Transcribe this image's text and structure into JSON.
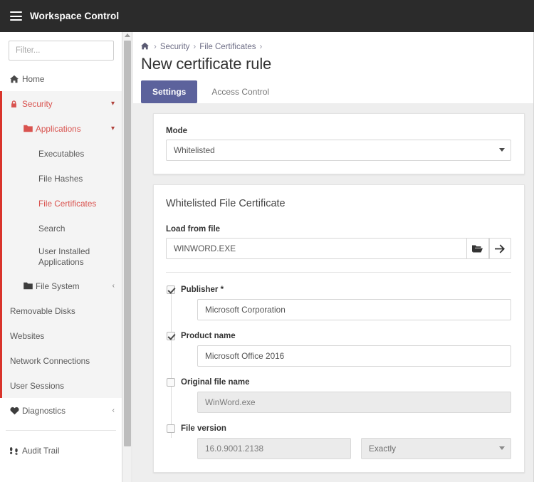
{
  "topbar": {
    "menu_icon": "hamburger-icon",
    "title": "Workspace Control"
  },
  "sidebar": {
    "filter_placeholder": "Filter...",
    "items": [
      {
        "label": "Home",
        "icon": "home-icon"
      },
      {
        "label": "Security",
        "icon": "lock-icon",
        "chevron": "chevron-down-icon"
      },
      {
        "label": "Applications",
        "icon": "folder-icon",
        "chevron": "chevron-down-icon"
      },
      {
        "label": "Executables"
      },
      {
        "label": "File Hashes"
      },
      {
        "label": "File Certificates"
      },
      {
        "label": "Search"
      },
      {
        "label": "User Installed Applications"
      },
      {
        "label": "File System",
        "icon": "folder-icon",
        "chevron": "chevron-left-icon"
      },
      {
        "label": "Removable Disks"
      },
      {
        "label": "Websites"
      },
      {
        "label": "Network Connections"
      },
      {
        "label": "User Sessions"
      },
      {
        "label": "Diagnostics",
        "icon": "heartbeat-icon",
        "chevron": "chevron-left-icon"
      },
      {
        "label": "Audit Trail",
        "icon": "footprints-icon"
      }
    ]
  },
  "main": {
    "breadcrumb": {
      "home_icon": "home-icon",
      "items": [
        "Security",
        "File Certificates"
      ],
      "separator": "›"
    },
    "page_title": "New certificate rule",
    "tabs": [
      {
        "label": "Settings",
        "active": true
      },
      {
        "label": "Access Control",
        "active": false
      }
    ],
    "mode_card": {
      "label": "Mode",
      "value": "Whitelisted",
      "caret_icon": "chevron-down-icon"
    },
    "certificate_card": {
      "title": "Whitelisted File Certificate",
      "load_from_file": {
        "label": "Load from file",
        "value": "WINWORD.EXE",
        "browse_icon": "folder-open-icon",
        "submit_icon": "arrow-right-icon"
      },
      "fields": [
        {
          "label": "Publisher *",
          "checked": true,
          "value": "Microsoft Corporation",
          "disabled": false
        },
        {
          "label": "Product name",
          "checked": true,
          "value": "Microsoft Office 2016",
          "disabled": false
        },
        {
          "label": "Original file name",
          "checked": false,
          "value": "WinWord.exe",
          "disabled": true
        },
        {
          "label": "File version",
          "checked": false,
          "value": "16.0.9001.2138",
          "disabled": true,
          "match": "Exactly"
        }
      ]
    }
  },
  "colors": {
    "topbar_bg": "#2b2b2b",
    "accent_red": "#d9534f",
    "accent_red_bar": "#d9342b",
    "tab_active_bg": "#5c629c",
    "main_bg": "#eeeeee"
  }
}
